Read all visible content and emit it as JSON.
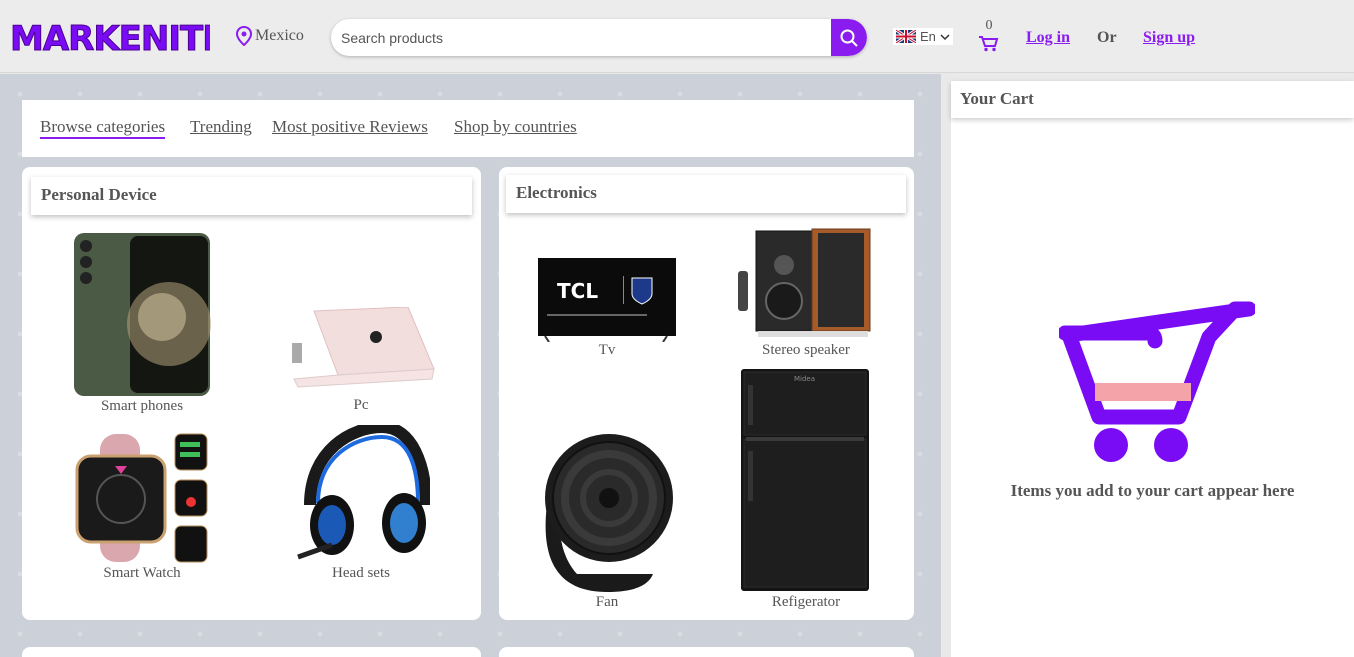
{
  "header": {
    "logo_text": "MARKENITE",
    "location": "Mexico",
    "search_placeholder": "Search products",
    "language": "En",
    "cart_count": "0",
    "login": "Log in",
    "or": "Or",
    "signup": "Sign up"
  },
  "tabs": [
    "Browse categories",
    "Trending",
    "Most positive Reviews",
    "Shop by countries"
  ],
  "categories": [
    {
      "title": "Personal Device",
      "items": [
        "Smart phones",
        "Pc",
        "Smart Watch",
        "Head sets"
      ]
    },
    {
      "title": "Electronics",
      "items": [
        "Tv",
        "Stereo speaker",
        "Fan",
        "Refigerator"
      ]
    }
  ],
  "tv_brand": "TCL",
  "cart": {
    "title": "Your Cart",
    "empty_message": "Items you add to your cart appear here"
  },
  "colors": {
    "accent": "#8a1cf0",
    "cart_icon": "#7a0cf5",
    "cart_band": "#f4a3a8"
  }
}
